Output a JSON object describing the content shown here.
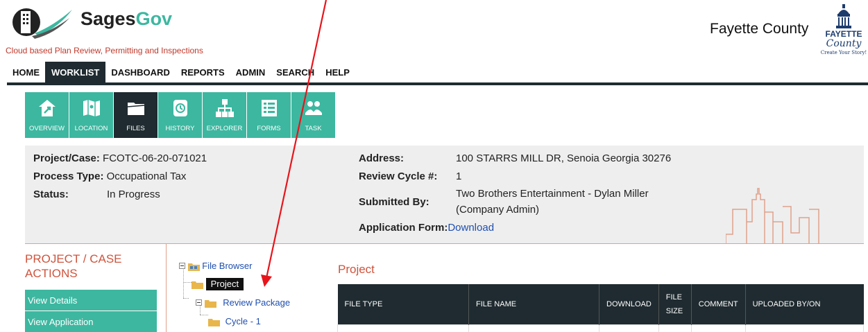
{
  "header": {
    "brand_sages": "Sages",
    "brand_gov": "Gov",
    "tagline": "Cloud based Plan Review, Permitting and Inspections",
    "county_name": "Fayette County",
    "county_logo": {
      "line1": "FAYETTE",
      "line2": "County",
      "line3": "Create Your Story!"
    }
  },
  "mainnav": [
    "HOME",
    "WORKLIST",
    "DASHBOARD",
    "REPORTS",
    "ADMIN",
    "SEARCH",
    "HELP"
  ],
  "tiles": [
    {
      "label": "OVERVIEW",
      "icon": "overview-icon"
    },
    {
      "label": "LOCATION",
      "icon": "map-icon"
    },
    {
      "label": "FILES",
      "icon": "folder-icon"
    },
    {
      "label": "HISTORY",
      "icon": "history-icon"
    },
    {
      "label": "EXPLORER",
      "icon": "sitemap-icon"
    },
    {
      "label": "FORMS",
      "icon": "form-icon"
    },
    {
      "label": "TASK",
      "icon": "task-icon"
    }
  ],
  "info": {
    "project_label": "Project/Case:",
    "project_value": "FCOTC-06-20-071021",
    "process_label": "Process Type:",
    "process_value": "Occupational Tax",
    "status_label": "Status:",
    "status_value": "In Progress",
    "address_label": "Address:",
    "address_value": "100 STARRS MILL DR, Senoia Georgia 30276",
    "cycle_label": "Review Cycle #:",
    "cycle_value": "1",
    "submitted_label": "Submitted By:",
    "submitted_line1": "Two Brothers Entertainment - Dylan Miller",
    "submitted_line2": "(Company Admin)",
    "appform_label": "Application Form:",
    "appform_link": "Download"
  },
  "actions": {
    "title_line1": "PROJECT / CASE",
    "title_line2": "ACTIONS",
    "buttons": [
      "View Details",
      "View Application"
    ]
  },
  "tree": {
    "root": "File Browser",
    "project": "Project",
    "review_package": "Review Package",
    "cycle": "Cycle - 1"
  },
  "files": {
    "title": "Project",
    "headers": [
      "FILE TYPE",
      "FILE NAME",
      "DOWNLOAD",
      "FILE SIZE",
      "COMMENT",
      "UPLOADED BY/ON"
    ]
  },
  "colors": {
    "teal": "#3db7a0",
    "dark": "#1f2b30",
    "orange": "#d0533b",
    "link": "#1e4fb0",
    "annotation": "#e8141b"
  }
}
